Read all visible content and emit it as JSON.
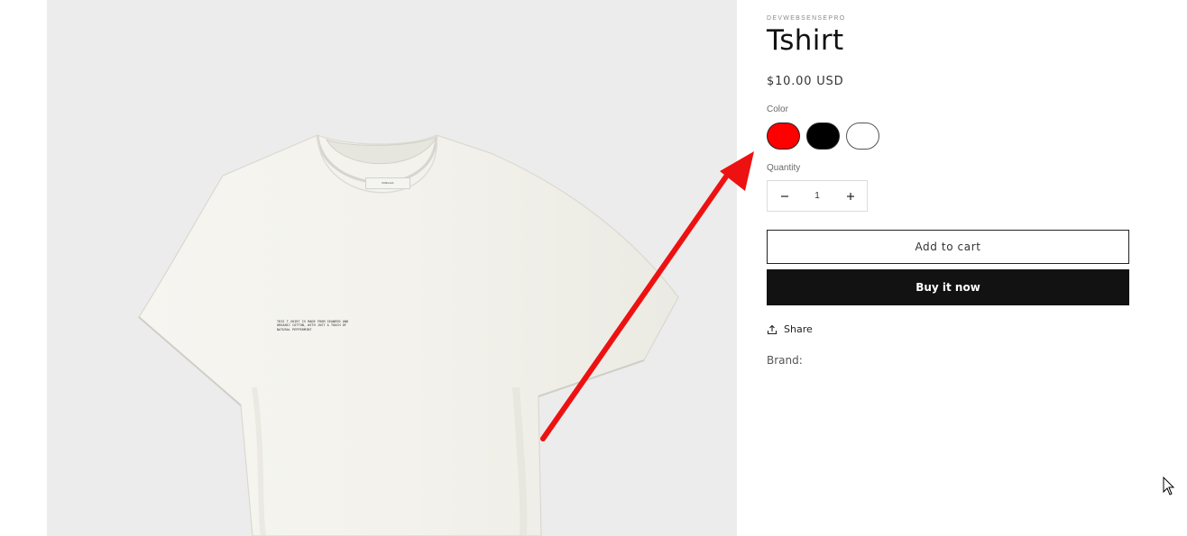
{
  "product": {
    "vendor": "DEVWEBSENSEPRO",
    "title": "Tshirt",
    "price": "$10.00 USD",
    "image_print_text": "THIS T-SHIRT IS MADE FROM SEAWEED AND ORGANIC COTTON, WITH JUST A TOUCH OF NATURAL PEPPERMINT",
    "image_tag_text": "PANGAIA"
  },
  "color": {
    "label": "Color",
    "options": [
      {
        "name": "Red",
        "hex": "#ff0000"
      },
      {
        "name": "Black",
        "hex": "#000000"
      },
      {
        "name": "White",
        "hex": "#ffffff"
      }
    ]
  },
  "quantity": {
    "label": "Quantity",
    "value": "1",
    "minus_icon": "minus-icon",
    "plus_icon": "plus-icon"
  },
  "actions": {
    "add_to_cart": "Add to cart",
    "buy_now": "Buy it now",
    "share": "Share",
    "share_icon": "share-icon"
  },
  "brand_label": "Brand:",
  "annotation": {
    "arrow_color": "#ee1111",
    "arrow_icon": "red-annotation-arrow"
  },
  "colors": {
    "gallery_bg": "#ececec",
    "tshirt": "#f4f3ee",
    "buy_button_bg": "#121212"
  }
}
